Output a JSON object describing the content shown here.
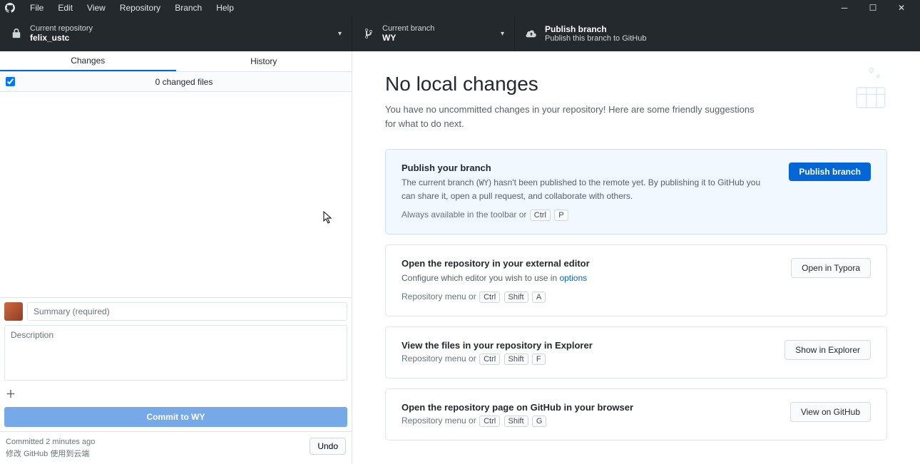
{
  "menu": {
    "file": "File",
    "edit": "Edit",
    "view": "View",
    "repository": "Repository",
    "branch": "Branch",
    "help": "Help"
  },
  "toolbar": {
    "repo_label": "Current repository",
    "repo_value": "felix_ustc",
    "branch_label": "Current branch",
    "branch_value": "WY",
    "publish_label": "Publish branch",
    "publish_sub": "Publish this branch to GitHub"
  },
  "tabs": {
    "changes": "Changes",
    "history": "History"
  },
  "changes": {
    "count_text": "0 changed files"
  },
  "commit": {
    "summary_placeholder": "Summary (required)",
    "description_placeholder": "Description",
    "button_prefix": "Commit to ",
    "button_branch": "WY"
  },
  "last_commit": {
    "line1": "Committed 2 minutes ago",
    "line2": "修改 GitHub 使用到云端",
    "undo": "Undo"
  },
  "hero": {
    "title": "No local changes",
    "subtitle": "You have no uncommitted changes in your repository! Here are some friendly suggestions for what to do next."
  },
  "cards": {
    "publish": {
      "title": "Publish your branch",
      "desc_before": "The current branch (",
      "desc_branch": "WY",
      "desc_after": ") hasn't been published to the remote yet. By publishing it to GitHub you can share it, open a pull request, and collaborate with others.",
      "hint_prefix": "Always available in the toolbar or",
      "key1": "Ctrl",
      "key2": "P",
      "button": "Publish branch"
    },
    "editor": {
      "title": "Open the repository in your external editor",
      "desc_before": "Configure which editor you wish to use in ",
      "desc_link": "options",
      "hint_prefix": "Repository menu or",
      "key1": "Ctrl",
      "key2": "Shift",
      "key3": "A",
      "button": "Open in Typora"
    },
    "explorer": {
      "title": "View the files in your repository in Explorer",
      "hint_prefix": "Repository menu or",
      "key1": "Ctrl",
      "key2": "Shift",
      "key3": "F",
      "button": "Show in Explorer"
    },
    "github": {
      "title": "Open the repository page on GitHub in your browser",
      "hint_prefix": "Repository menu or",
      "key1": "Ctrl",
      "key2": "Shift",
      "key3": "G",
      "button": "View on GitHub"
    }
  }
}
